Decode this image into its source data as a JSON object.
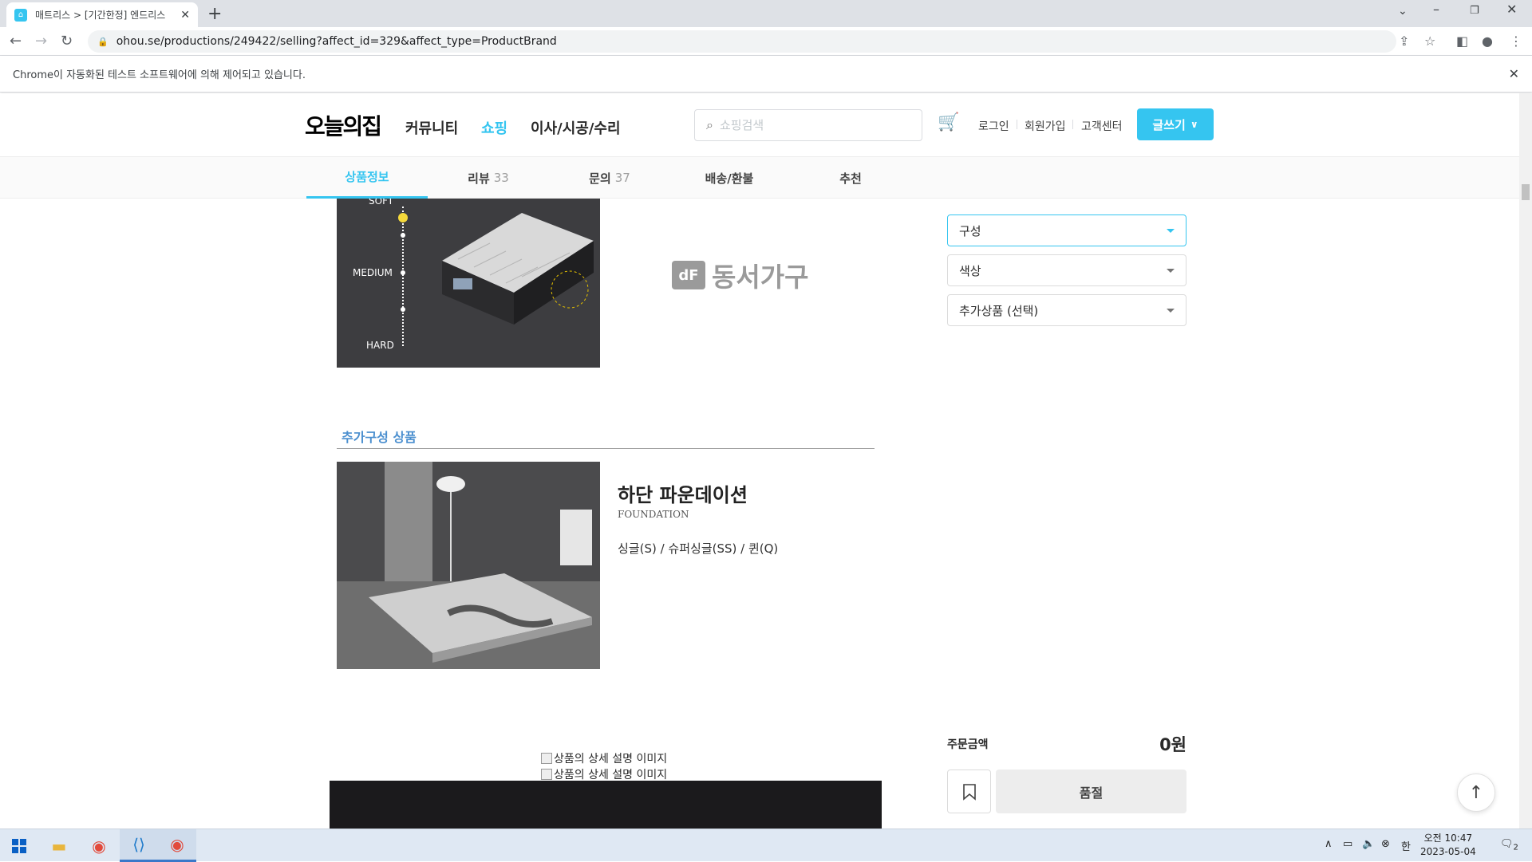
{
  "browser": {
    "tab_title": "매트리스 > [기간한정] 엔드리스",
    "tab_favicon": "ohouse-favicon",
    "url": "ohou.se/productions/249422/selling?affect_id=329&affect_type=ProductBrand",
    "infobar_text": "Chrome이 자동화된 테스트 소프트웨어에 의해 제어되고 있습니다."
  },
  "header": {
    "logo": "오늘의집",
    "nav": [
      "커뮤니티",
      "쇼핑",
      "이사/시공/수리"
    ],
    "search_placeholder": "쇼핑검색",
    "login": "로그인",
    "signup": "회원가입",
    "support": "고객센터",
    "write": "글쓰기"
  },
  "product_tabs": [
    {
      "label": "상품정보",
      "count": ""
    },
    {
      "label": "리뷰",
      "count": "33"
    },
    {
      "label": "문의",
      "count": "37"
    },
    {
      "label": "배송/환불",
      "count": ""
    },
    {
      "label": "추천",
      "count": ""
    }
  ],
  "content": {
    "hardness": {
      "soft": "SOFT",
      "medium": "MEDIUM",
      "hard": "HARD"
    },
    "brand_mark": "dF",
    "brand_name": "동서가구",
    "section_title": "추가구성 상품",
    "foundation": {
      "title": "하단 파운데이션",
      "subtitle": "FOUNDATION",
      "sizes": "싱글(S) / 슈퍼싱글(SS) / 퀸(Q)"
    },
    "broken_image_alt": "상품의 상세 설명 이미지"
  },
  "options": {
    "select1": "구성",
    "select2": "색상",
    "select3": "추가상품 (선택)",
    "order_label": "주문금액",
    "order_price": "0원",
    "soldout": "품절"
  },
  "taskbar": {
    "time": "오전 10:47",
    "date": "2023-05-04",
    "ime": "한",
    "notifications": "2"
  },
  "colors": {
    "accent": "#35c5f0",
    "section_title": "#4b8fcf"
  }
}
